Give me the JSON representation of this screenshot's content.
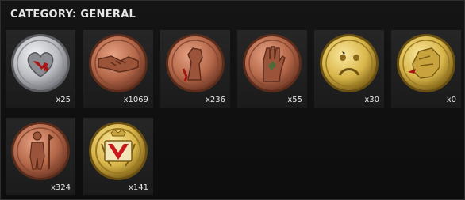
{
  "category_title": "CATEGORY: GENERAL",
  "medals": [
    {
      "icon": "bloody-heart-medal-icon",
      "metal": "silver",
      "count": "x25"
    },
    {
      "icon": "handshake-medal-icon",
      "metal": "copper",
      "count": "x1069"
    },
    {
      "icon": "raised-fist-medal-icon",
      "metal": "copper",
      "count": "x236"
    },
    {
      "icon": "hand-medal-icon",
      "metal": "copper",
      "count": "x55"
    },
    {
      "icon": "sad-face-medal-icon",
      "metal": "gold",
      "count": "x30"
    },
    {
      "icon": "face-profile-medal-icon",
      "metal": "gold",
      "count": "x0"
    },
    {
      "icon": "standing-soldier-medal-icon",
      "metal": "copper",
      "count": "x324"
    },
    {
      "icon": "v-emblem-medal-icon",
      "metal": "gold",
      "count": "x141"
    }
  ],
  "colors": {
    "silver": "#c9cbd0",
    "copper": "#b5684a",
    "gold": "#d8b64a",
    "blood": "#a81515"
  }
}
